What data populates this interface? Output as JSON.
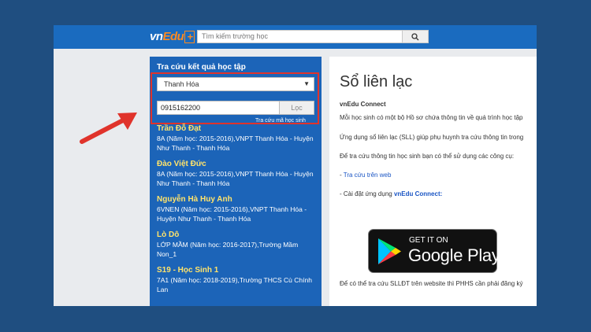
{
  "header": {
    "logo": {
      "part1": "vn",
      "part2": "Edu",
      "part3": "+"
    },
    "search_placeholder": "Tìm kiếm trường học",
    "search_icon": "search-icon"
  },
  "sidebar": {
    "title": "Tra cứu kết quả học tập",
    "province": "Thanh Hóa",
    "phone": "0915162200",
    "filter_label": "Lọc",
    "captcha_label": "Tra cứu mã học sinh",
    "results": [
      {
        "name": "Trần Đỗ Đạt",
        "info": "8A (Năm học: 2015-2016),VNPT Thanh Hóa - Huyện Như Thanh - Thanh Hóa"
      },
      {
        "name": "Đào Việt Đức",
        "info": "8A (Năm học: 2015-2016),VNPT Thanh Hóa - Huyện Như Thanh - Thanh Hóa"
      },
      {
        "name": "Nguyễn Hà Huy Anh",
        "info": "6VNEN (Năm học: 2015-2016),VNPT Thanh Hóa - Huyện Như Thanh - Thanh Hóa"
      },
      {
        "name": "Lò Dô",
        "info": "LỚP MẦM (Năm học: 2016-2017),Trường Mầm Non_1"
      },
      {
        "name": "S19 - Học Sinh 1",
        "info": "7A1 (Năm học: 2018-2019),Trường THCS Cù Chính Lan"
      }
    ]
  },
  "content": {
    "title": "Sổ liên lạc",
    "subtitle": "vnEdu Connect",
    "p1": "Mỗi học sinh có một bộ Hồ sơ chứa thông tin về quá trình học tập",
    "p2": "Ứng dụng sổ liên lạc (SLL) giúp phụ huynh tra cứu thông tin trong",
    "p3": "Để tra cứu thông tin học sinh bạn có thể sử dụng các công cụ:",
    "link_prefix": "- ",
    "link_text": "Tra cứu trên web",
    "app_prefix": "- Cài đặt ứng dụng ",
    "app_name": "vnEdu Connect:",
    "p4": "Để có thể tra cứu SLLĐT trên website thì PHHS cần phải đăng ký",
    "google_play": {
      "small": "GET IT ON",
      "big": "Google Play"
    }
  },
  "colors": {
    "page_bg": "#1f4e80",
    "topbar": "#1a6bbf",
    "sidebar": "#1c64b8",
    "highlight": "#e0332b",
    "arrow": "#e0332b",
    "student_name": "#ffe36b"
  }
}
